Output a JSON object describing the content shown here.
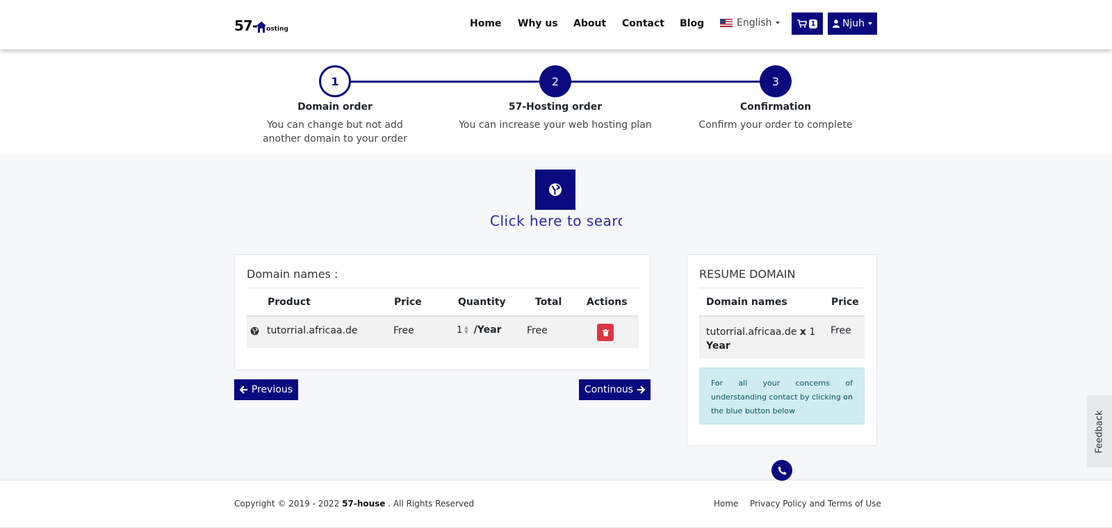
{
  "header": {
    "logo": {
      "main": "57-",
      "house": "H",
      "sub": "osting"
    },
    "nav": [
      "Home",
      "Why us",
      "About",
      "Contact",
      "Blog"
    ],
    "language": "English",
    "cart_count": "1",
    "user": "Njuh",
    "brand_color": "#0a0a7e"
  },
  "steps": [
    {
      "number": "1",
      "title": "Domain order",
      "desc": "You can change but not add another domain to your order"
    },
    {
      "number": "2",
      "title": "57-Hosting order",
      "desc": "You can increase your web hosting plan"
    },
    {
      "number": "3",
      "title": "Confirmation",
      "desc": "Confirm your order to complete"
    }
  ],
  "search": {
    "text": "Click here to search"
  },
  "domain_card": {
    "title": "Domain names :",
    "headers": [
      "Product",
      "Price",
      "Quantity",
      "Total",
      "Actions"
    ],
    "row": {
      "product": "tutorrial.africaa.de",
      "price": "Free",
      "quantity": "1",
      "unit": "/Year",
      "total": "Free"
    }
  },
  "buttons": {
    "previous": "Previous",
    "continue": "Continous"
  },
  "resume": {
    "title": "RESUME DOMAIN",
    "headers": [
      "Domain names",
      "Price"
    ],
    "row": {
      "domain": "tutorrial.africaa.de",
      "times": "x",
      "qty": "1",
      "period": "Year",
      "price": "Free"
    },
    "info": "For all your concerns of understanding contact by clicking on the blue button below"
  },
  "feedback": "Feedback",
  "footer": {
    "copyright_prefix": "Copyright © 2019 - 2022",
    "brand": "57-house",
    "copyright_suffix": ". All Rights Reserved",
    "links": [
      "Home",
      "Privacy Policy and Terms of Use"
    ]
  }
}
